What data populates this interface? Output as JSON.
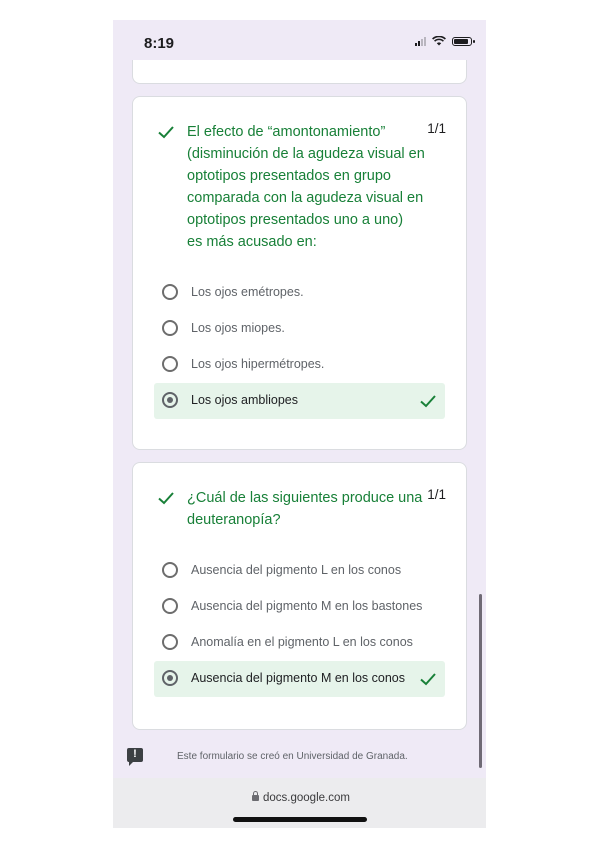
{
  "status_bar": {
    "time": "8:19"
  },
  "questions": [
    {
      "text": "El efecto de “amontonamiento”\n(disminución de la agudeza visual en\noptotipos presentados en grupo\ncomparada con la agudeza visual en\noptotipos presentados uno a uno)\nes más acusado en:",
      "score": "1/1",
      "options": [
        {
          "label": "Los ojos emétropes.",
          "selected": false,
          "correct": false
        },
        {
          "label": "Los ojos miopes.",
          "selected": false,
          "correct": false
        },
        {
          "label": "Los ojos hipermétropes.",
          "selected": false,
          "correct": false
        },
        {
          "label": "Los ojos ambliopes",
          "selected": true,
          "correct": true
        }
      ]
    },
    {
      "text": "¿Cuál de las siguientes produce una\ndeuteranopía?",
      "score": "1/1",
      "options": [
        {
          "label": "Ausencia del pigmento L en los conos",
          "selected": false,
          "correct": false
        },
        {
          "label": "Ausencia del pigmento M en los bastones",
          "selected": false,
          "correct": false
        },
        {
          "label": "Anomalía en el pigmento L en los conos",
          "selected": false,
          "correct": false
        },
        {
          "label": "Ausencia del pigmento M en los conos",
          "selected": true,
          "correct": true
        }
      ]
    }
  ],
  "footer": {
    "text": "Este formulario se creó en Universidad de Granada."
  },
  "browser": {
    "url": "docs.google.com"
  },
  "colors": {
    "accent_green": "#188038",
    "correct_bg": "#e6f4ea",
    "background": "#efeaf6"
  }
}
